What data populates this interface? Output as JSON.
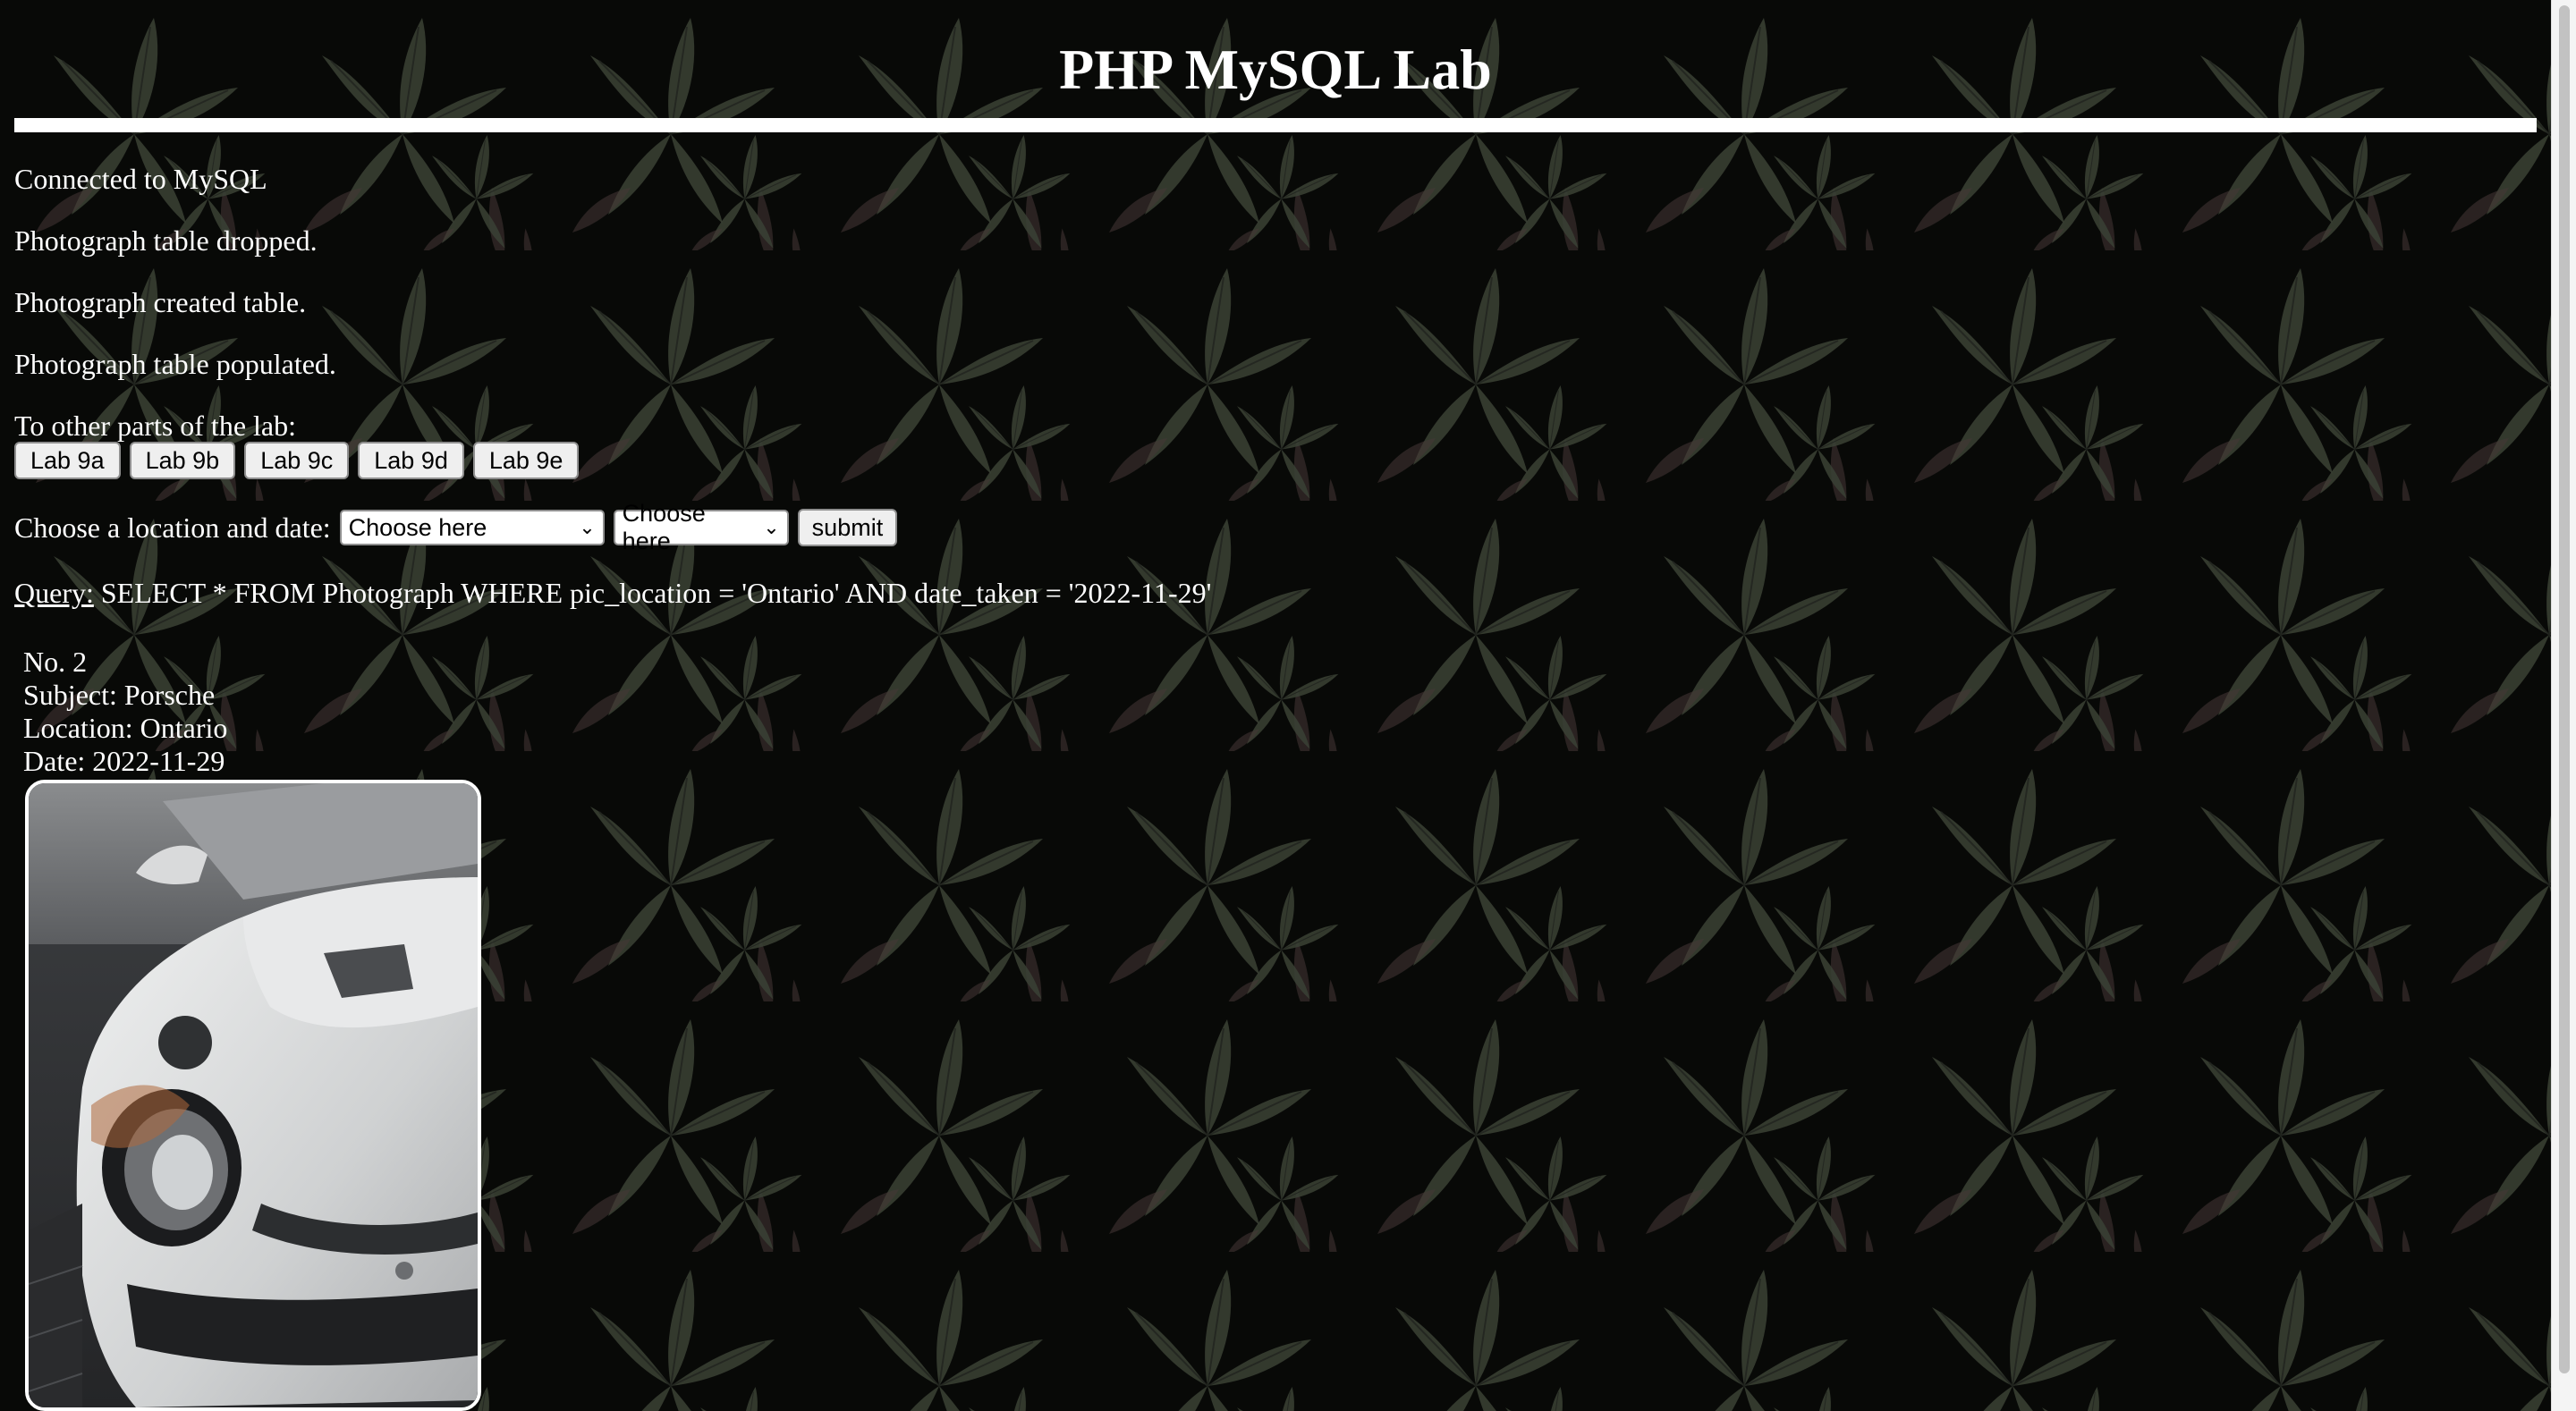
{
  "page": {
    "title": "PHP MySQL Lab"
  },
  "status": {
    "connected": "Connected to MySQL",
    "dropped": "Photograph table dropped.",
    "created": "Photograph created table.",
    "populated": "Photograph table populated."
  },
  "nav": {
    "label": "To other parts of the lab:",
    "buttons": [
      "Lab 9a",
      "Lab 9b",
      "Lab 9c",
      "Lab 9d",
      "Lab 9e"
    ]
  },
  "form": {
    "label": "Choose a location and date:",
    "location_select": "Choose here",
    "date_select": "Choose here",
    "submit": "submit"
  },
  "query": {
    "label": "Query:",
    "text": "SELECT * FROM Photograph WHERE pic_location = 'Ontario' AND date_taken = '2022-11-29'"
  },
  "result": {
    "number": "No. 2",
    "subject": "Subject: Porsche",
    "location": "Location: Ontario",
    "date": "Date: 2022-11-29",
    "photo_icon": "car-photo"
  },
  "colors": {
    "background": "#0b0c0a",
    "leaf": "#4d5746",
    "text": "#ffffff"
  }
}
